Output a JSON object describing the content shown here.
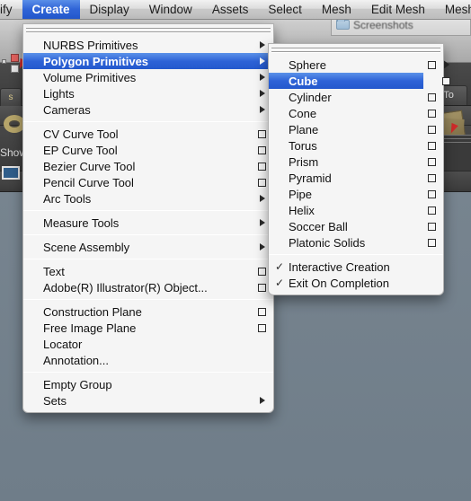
{
  "app": {
    "name": "Autodesk Maya",
    "background_color": "#6b7886",
    "accent_color": "#2d62d6"
  },
  "finder_window": {
    "title": "Screenshots",
    "icon": "folder-icon"
  },
  "menubar": {
    "items": [
      {
        "label": "ify",
        "active": false,
        "clipped": true
      },
      {
        "label": "Create",
        "active": true
      },
      {
        "label": "Display",
        "active": false
      },
      {
        "label": "Window",
        "active": false
      },
      {
        "label": "Assets",
        "active": false
      },
      {
        "label": "Select",
        "active": false
      },
      {
        "label": "Mesh",
        "active": false
      },
      {
        "label": "Edit Mesh",
        "active": false
      },
      {
        "label": "Mesh",
        "active": false,
        "clipped_right": true
      }
    ]
  },
  "viewport_widgets": {
    "shelf_tab_label": "s",
    "show_label": "Show",
    "right_tab_label": "To"
  },
  "create_menu": {
    "title": "Create",
    "groups": [
      {
        "items": [
          {
            "label": "NURBS Primitives",
            "submenu": true,
            "selected": false
          },
          {
            "label": "Polygon Primitives",
            "submenu": true,
            "selected": true
          },
          {
            "label": "Volume Primitives",
            "submenu": true,
            "selected": false
          },
          {
            "label": "Lights",
            "submenu": true,
            "selected": false
          },
          {
            "label": "Cameras",
            "submenu": true,
            "selected": false
          }
        ]
      },
      {
        "items": [
          {
            "label": "CV Curve Tool",
            "optionbox": true
          },
          {
            "label": "EP Curve Tool",
            "optionbox": true
          },
          {
            "label": "Bezier Curve Tool",
            "optionbox": true
          },
          {
            "label": "Pencil Curve Tool",
            "optionbox": true
          },
          {
            "label": "Arc Tools",
            "submenu": true
          }
        ]
      },
      {
        "items": [
          {
            "label": "Measure Tools",
            "submenu": true
          }
        ]
      },
      {
        "items": [
          {
            "label": "Scene Assembly",
            "submenu": true
          }
        ]
      },
      {
        "items": [
          {
            "label": "Text",
            "optionbox": true
          },
          {
            "label": "Adobe(R) Illustrator(R) Object...",
            "optionbox": true
          }
        ]
      },
      {
        "items": [
          {
            "label": "Construction Plane",
            "optionbox": true
          },
          {
            "label": "Free Image Plane",
            "optionbox": true
          },
          {
            "label": "Locator"
          },
          {
            "label": "Annotation..."
          }
        ]
      },
      {
        "items": [
          {
            "label": "Empty Group"
          },
          {
            "label": "Sets",
            "submenu": true
          }
        ]
      }
    ]
  },
  "polygon_primitives_submenu": {
    "title": "Polygon Primitives",
    "groups": [
      {
        "items": [
          {
            "label": "Sphere",
            "optionbox": true,
            "selected": false
          },
          {
            "label": "Cube",
            "optionbox": true,
            "selected": true
          },
          {
            "label": "Cylinder",
            "optionbox": true,
            "selected": false
          },
          {
            "label": "Cone",
            "optionbox": true,
            "selected": false
          },
          {
            "label": "Plane",
            "optionbox": true,
            "selected": false
          },
          {
            "label": "Torus",
            "optionbox": true,
            "selected": false
          },
          {
            "label": "Prism",
            "optionbox": true,
            "selected": false
          },
          {
            "label": "Pyramid",
            "optionbox": true,
            "selected": false
          },
          {
            "label": "Pipe",
            "optionbox": true,
            "selected": false
          },
          {
            "label": "Helix",
            "optionbox": true,
            "selected": false
          },
          {
            "label": "Soccer Ball",
            "optionbox": true,
            "selected": false
          },
          {
            "label": "Platonic Solids",
            "optionbox": true,
            "selected": false
          }
        ]
      },
      {
        "items": [
          {
            "label": "Interactive Creation",
            "checked": true
          },
          {
            "label": "Exit On Completion",
            "checked": true
          }
        ]
      }
    ]
  }
}
